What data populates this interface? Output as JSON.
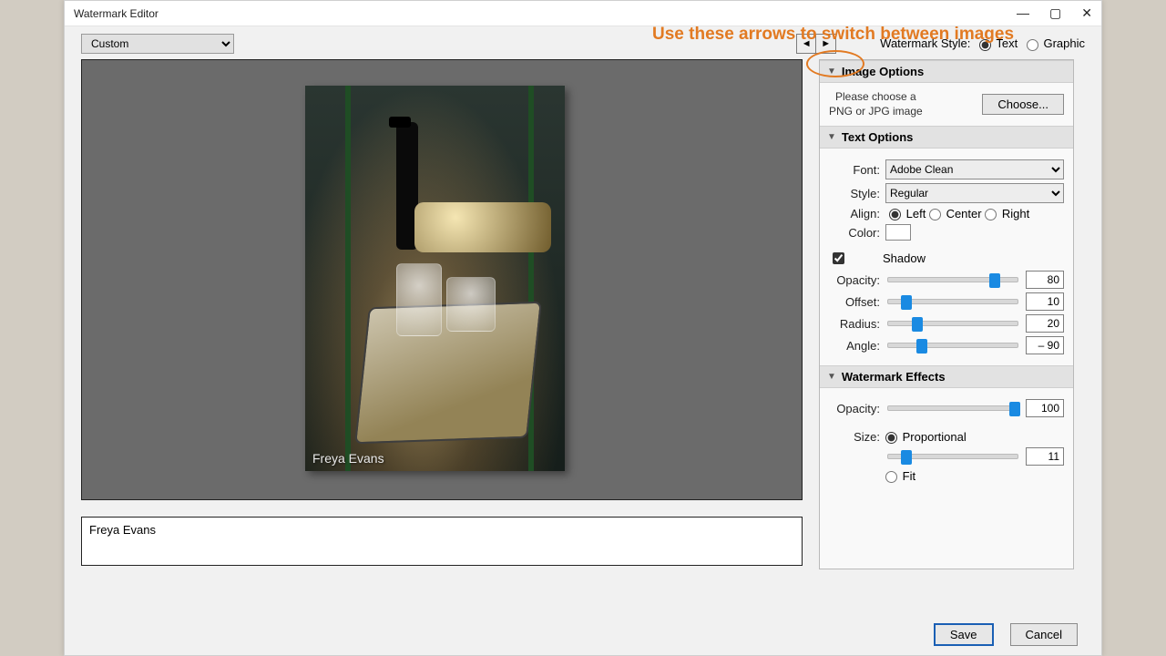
{
  "titlebar": {
    "title": "Watermark Editor"
  },
  "annotation": "Use these arrows to switch between images",
  "preset": {
    "value": "Custom"
  },
  "watermark_style": {
    "label": "Watermark Style:",
    "text": "Text",
    "graphic": "Graphic",
    "selected": "Text"
  },
  "panel": {
    "image_options": {
      "header": "Image Options",
      "hint1": "Please choose a",
      "hint2": "PNG or JPG image",
      "choose": "Choose..."
    },
    "text_options": {
      "header": "Text Options",
      "font_label": "Font:",
      "font_value": "Adobe Clean",
      "style_label": "Style:",
      "style_value": "Regular",
      "align_label": "Align:",
      "align_left": "Left",
      "align_center": "Center",
      "align_right": "Right",
      "align_selected": "Left",
      "color_label": "Color:",
      "shadow_label": "Shadow",
      "shadow_checked": true,
      "opacity_label": "Opacity:",
      "opacity_value": "80",
      "offset_label": "Offset:",
      "offset_value": "10",
      "radius_label": "Radius:",
      "radius_value": "20",
      "angle_label": "Angle:",
      "angle_value": "– 90"
    },
    "effects": {
      "header": "Watermark Effects",
      "opacity_label": "Opacity:",
      "opacity_value": "100",
      "size_label": "Size:",
      "proportional": "Proportional",
      "proportional_value": "11",
      "fit": "Fit"
    }
  },
  "watermark_text": "Freya Evans",
  "footer": {
    "save": "Save",
    "cancel": "Cancel"
  }
}
